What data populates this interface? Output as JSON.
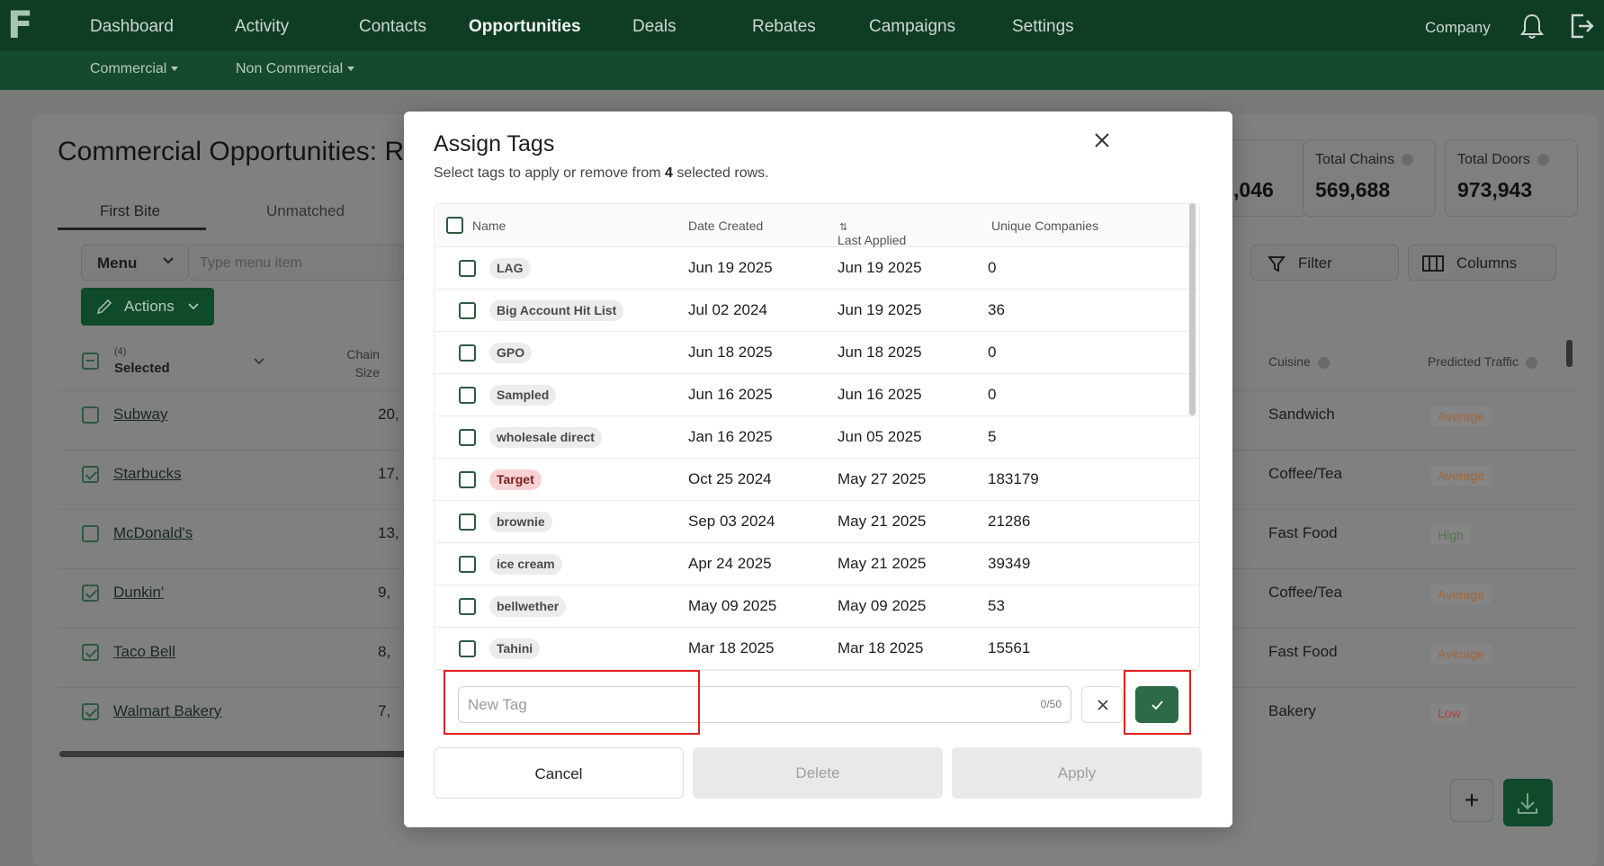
{
  "nav": {
    "logo": "F",
    "items": [
      "Dashboard",
      "Activity",
      "Contacts",
      "Opportunities",
      "Deals",
      "Rebates",
      "Campaigns",
      "Settings"
    ],
    "active": "Opportunities",
    "company_label": "Company",
    "sub_items": [
      "Commercial",
      "Non Commercial"
    ]
  },
  "background_page": {
    "title": "Commercial Opportunities: R",
    "tabs": [
      "First Bite",
      "Unmatched"
    ],
    "menu_select": "Menu",
    "menu_placeholder": "Type menu item",
    "actions_label": "Actions",
    "filter_label": "Filter",
    "columns_label": "Columns",
    "selected_count": "(4)",
    "selected_label": "Selected",
    "chain_size_header": "Chain Size",
    "cuisine_header": "Cuisine",
    "predicted_traffic_header": "Predicted Traffic",
    "stats": [
      {
        "label": "",
        "value": ",046"
      },
      {
        "label": "Total Chains",
        "value": "569,688"
      },
      {
        "label": "Total Doors",
        "value": "973,943"
      }
    ],
    "rows": [
      {
        "name": "Subway",
        "chain_size": "20,",
        "checked": false,
        "cuisine": "Sandwich",
        "traffic": "Average"
      },
      {
        "name": "Starbucks",
        "chain_size": "17,",
        "checked": true,
        "cuisine": "Coffee/Tea",
        "traffic": "Average"
      },
      {
        "name": "McDonald's",
        "chain_size": "13,",
        "checked": false,
        "cuisine": "Fast Food",
        "traffic": "High"
      },
      {
        "name": "Dunkin'",
        "chain_size": "9,",
        "checked": true,
        "cuisine": "Coffee/Tea",
        "traffic": "Average"
      },
      {
        "name": "Taco Bell",
        "chain_size": "8,",
        "checked": true,
        "cuisine": "Fast Food",
        "traffic": "Average"
      },
      {
        "name": "Walmart Bakery",
        "chain_size": "7,",
        "checked": true,
        "cuisine": "Bakery",
        "traffic": "Low"
      }
    ]
  },
  "modal": {
    "title": "Assign Tags",
    "subtitle_prefix": "Select tags to apply or remove from ",
    "subtitle_count": "4",
    "subtitle_suffix": " selected rows.",
    "columns": [
      "Name",
      "Date Created",
      "Last Applied",
      "Unique Companies"
    ],
    "sort_indicator": "⇅",
    "tags": [
      {
        "name": "LAG",
        "created": "Jun 19 2025",
        "last_applied": "Jun 19 2025",
        "companies": "0",
        "style": "default"
      },
      {
        "name": "Big Account Hit List",
        "created": "Jul 02 2024",
        "last_applied": "Jun 19 2025",
        "companies": "36",
        "style": "default"
      },
      {
        "name": "GPO",
        "created": "Jun 18 2025",
        "last_applied": "Jun 18 2025",
        "companies": "0",
        "style": "default"
      },
      {
        "name": "Sampled",
        "created": "Jun 16 2025",
        "last_applied": "Jun 16 2025",
        "companies": "0",
        "style": "default"
      },
      {
        "name": "wholesale direct",
        "created": "Jan 16 2025",
        "last_applied": "Jun 05 2025",
        "companies": "5",
        "style": "default"
      },
      {
        "name": "Target",
        "created": "Oct 25 2024",
        "last_applied": "May 27 2025",
        "companies": "183179",
        "style": "red"
      },
      {
        "name": "brownie",
        "created": "Sep 03 2024",
        "last_applied": "May 21 2025",
        "companies": "21286",
        "style": "default"
      },
      {
        "name": "ice cream",
        "created": "Apr 24 2025",
        "last_applied": "May 21 2025",
        "companies": "39349",
        "style": "default"
      },
      {
        "name": "bellwether",
        "created": "May 09 2025",
        "last_applied": "May 09 2025",
        "companies": "53",
        "style": "default"
      },
      {
        "name": "Tahini",
        "created": "Mar 18 2025",
        "last_applied": "Mar 18 2025",
        "companies": "15561",
        "style": "default"
      }
    ],
    "new_tag_placeholder": "New Tag",
    "new_tag_counter": "0/50",
    "cancel_label": "Cancel",
    "delete_label": "Delete",
    "apply_label": "Apply"
  },
  "colors": {
    "nav_bg": "#0f3d24",
    "subnav_bg": "#154a2e",
    "primary_green": "#2b6b45",
    "highlight_red": "#e02020",
    "tag_red_bg": "#f8d2d2"
  }
}
